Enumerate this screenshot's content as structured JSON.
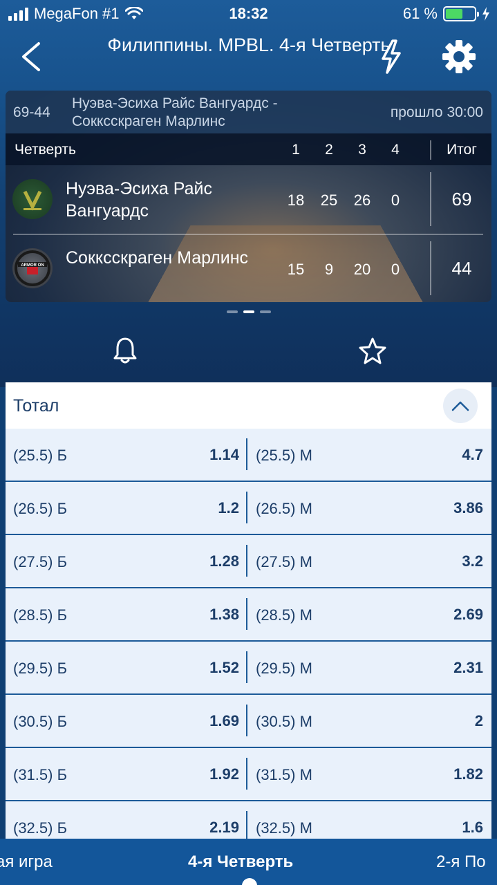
{
  "status_bar": {
    "carrier": "MegaFon #1",
    "time": "18:32",
    "battery": "61 %",
    "battery_level": 0.61
  },
  "header": {
    "title": "Филиппины. MPBL. 4-я Четверть"
  },
  "scoreboard": {
    "score": "69-44",
    "match": "Нуэва-Эсиха Райс Вангуардс - Сокксскраген Марлинс",
    "elapsed": "прошло 30:00",
    "header": {
      "label": "Четверть",
      "q1": "1",
      "q2": "2",
      "q3": "3",
      "q4": "4",
      "total": "Итог"
    },
    "teams": [
      {
        "name": "Нуэва-Эсиха Райс Вангуардс",
        "logo": "vanguards-logo",
        "q1": "18",
        "q2": "25",
        "q3": "26",
        "q4": "0",
        "total": "69"
      },
      {
        "name": "Сокксскраген Марлинс",
        "logo": "marlins-logo",
        "logo_text": "ARMOR ON",
        "q1": "15",
        "q2": "9",
        "q3": "20",
        "q4": "0",
        "total": "44"
      }
    ]
  },
  "market": {
    "title": "Тотал",
    "rows": [
      {
        "over": "(25.5) Б",
        "over_odds": "1.14",
        "under": "(25.5) М",
        "under_odds": "4.7"
      },
      {
        "over": "(26.5) Б",
        "over_odds": "1.2",
        "under": "(26.5) М",
        "under_odds": "3.86"
      },
      {
        "over": "(27.5) Б",
        "over_odds": "1.28",
        "under": "(27.5) М",
        "under_odds": "3.2"
      },
      {
        "over": "(28.5) Б",
        "over_odds": "1.38",
        "under": "(28.5) М",
        "under_odds": "2.69"
      },
      {
        "over": "(29.5) Б",
        "over_odds": "1.52",
        "under": "(29.5) М",
        "under_odds": "2.31"
      },
      {
        "over": "(30.5) Б",
        "over_odds": "1.69",
        "under": "(30.5) М",
        "under_odds": "2"
      },
      {
        "over": "(31.5) Б",
        "over_odds": "1.92",
        "under": "(31.5) М",
        "under_odds": "1.82"
      },
      {
        "over": "(32.5) Б",
        "over_odds": "2.19",
        "under": "(32.5) М",
        "under_odds": "1.6"
      }
    ]
  },
  "bottom_tabs": {
    "left": "ая игра",
    "active": "4-я Четверть",
    "right": "2-я По"
  },
  "colors": {
    "brand_blue": "#13569a",
    "text_dark": "#1c3d68",
    "battery_green": "#4cd964"
  }
}
